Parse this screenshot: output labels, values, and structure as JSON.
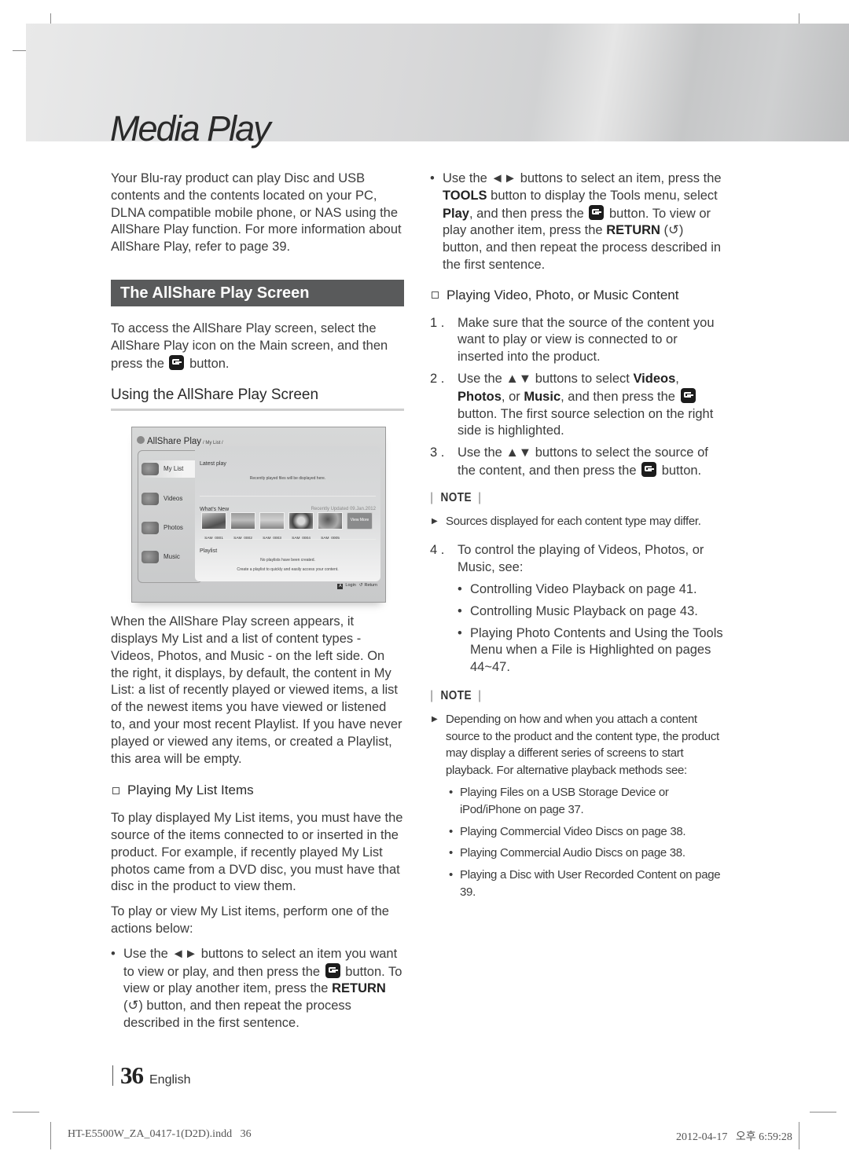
{
  "chapter_title": "Media Play",
  "left": {
    "intro": "Your Blu-ray product can play Disc and USB contents and the contents located on your PC, DLNA compatible mobile phone, or NAS using the AllShare Play function. For more information about AllShare Play, refer to page 39.",
    "section_title": "The AllShare Play Screen",
    "access_text_before": "To access the AllShare Play screen, select the AllShare Play icon on the Main screen, and then press the",
    "access_text_after": "button.",
    "sub_heading": "Using the AllShare Play Screen",
    "screen": {
      "title": "AllShare Play",
      "path": "/ My List /",
      "menu": [
        {
          "label": "My List",
          "icon": "mylist-icon",
          "selected": true
        },
        {
          "label": "Videos",
          "icon": "videos-icon",
          "selected": false
        },
        {
          "label": "Photos",
          "icon": "photos-icon",
          "selected": false
        },
        {
          "label": "Music",
          "icon": "music-icon",
          "selected": false
        }
      ],
      "latest_play_label": "Latest play",
      "latest_play_empty": "Recently played files will be displayed here.",
      "whats_new_label": "What's New",
      "recently_updated": "Recently Updated 09.Jan.2012",
      "thumbnails": [
        "SAM_0001",
        "SAM_0002",
        "SAM_0003",
        "SAM_0004",
        "SAM_0005"
      ],
      "view_more": "View More",
      "playlist_label": "Playlist",
      "playlist_empty_1": "No playlists have been created.",
      "playlist_empty_2": "Create a playlist to quickly and easily access your content.",
      "footer_login_key": "A",
      "footer_login": "Login",
      "footer_return_icon": "↺",
      "footer_return": "Return"
    },
    "description": "When the AllShare Play screen appears, it displays My List and a list of content types - Videos, Photos, and Music - on the left side. On the right, it displays, by default, the content in My List: a list of recently played or viewed items, a list of the newest items you have viewed or listened to, and your most recent Playlist. If you have never played or viewed any items, or created a Playlist, this area will be empty.",
    "playing_heading": "Playing My List Items",
    "playing_para1": "To play displayed My List items, you must have the source of the items connected to or inserted in the product. For example, if recently played My List photos came from a DVD disc, you must have that disc in the product to view them.",
    "playing_para2": "To play or view My List items, perform one of the actions below:",
    "bullet1": {
      "part1": "Use the ◄► buttons to select an item you want to view or play, and then press the",
      "part2": "button. To view or play another item, press the",
      "return_label": "RETURN",
      "part3": "(↺) button, and then repeat the process described in the first sentence."
    }
  },
  "right": {
    "bullet2": {
      "part1": "Use the ◄► buttons to select an item, press the",
      "tools_label": "TOOLS",
      "part2": "button to display the Tools menu, select",
      "play_label": "Play",
      "part3": ", and then press the",
      "part4": "button. To view or play another item, press the",
      "return_label": "RETURN",
      "part5": "(↺) button, and then repeat the process described in the first sentence."
    },
    "content_heading": "Playing Video, Photo, or Music Content",
    "steps": {
      "s1_num": "1 .",
      "s1": "Make sure that the source of the content you want to play or view is connected to or inserted into the product.",
      "s2_num": "2 .",
      "s2_a": "Use the ▲▼ buttons to select",
      "s2_videos": "Videos",
      "s2_b": ",",
      "s2_photos": "Photos",
      "s2_c": ", or",
      "s2_music": "Music",
      "s2_d": ", and then press the",
      "s2_e": "button. The first source selection on the right side is highlighted.",
      "s3_num": "3 .",
      "s3_a": "Use the ▲▼ buttons to select the source of the content, and then press the",
      "s3_b": "button.",
      "s4_num": "4 .",
      "s4": "To control the playing of Videos, Photos, or Music, see:",
      "s4_links": [
        "Controlling Video Playback on page 41.",
        "Controlling Music Playback on page 43.",
        "Playing Photo Contents and Using the Tools Menu when a File is Highlighted on pages 44~47."
      ]
    },
    "note_label": "NOTE",
    "note1": "Sources displayed for each content type may differ.",
    "note2": "Depending on how and when you attach a content source to the product and the content type, the product may display a different series of screens to start playback. For alternative playback methods see:",
    "note2_links": [
      "Playing Files on a USB Storage Device or iPod/iPhone on page 37.",
      "Playing Commercial Video Discs on page 38.",
      "Playing Commercial Audio Discs on page 38.",
      "Playing a Disc with User Recorded Content on page 39."
    ]
  },
  "footer": {
    "page_number": "36",
    "language": "English",
    "file_slug": "HT-E5500W_ZA_0417-1(D2D).indd   36",
    "timestamp": "2012-04-17   오후 6:59:28"
  },
  "colors": {
    "section_bar": "#595a5b",
    "text": "#3c3c3c"
  }
}
